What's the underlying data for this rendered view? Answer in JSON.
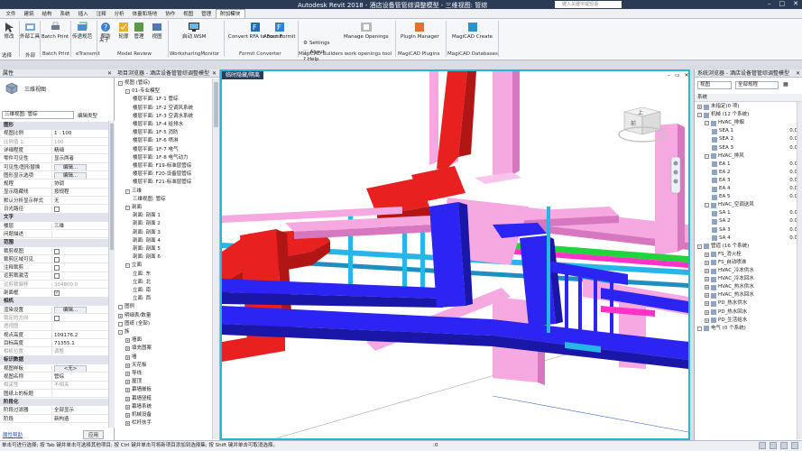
{
  "titlebar": {
    "app_title": "Autodesk Revit 2018 -",
    "doc_title": "酒店设备管管综调整模型 - 三维视图: 管综",
    "search_placeholder": "键入关键字或短语"
  },
  "tabs": [
    "文件",
    "建筑",
    "结构",
    "系统",
    "插入",
    "注释",
    "分析",
    "体量和场地",
    "协作",
    "视图",
    "管理",
    "附加模块"
  ],
  "addin_tabs": [
    "设置定义",
    "给排水",
    "消防系统",
    "计算工具",
    "风系统",
    "水系统",
    "详细信息",
    "多专业系统",
    "模型检查",
    "标注",
    "管道",
    "标准",
    "专业综合",
    "系统图/电气工具",
    "出图统计",
    "模板",
    "通用工具"
  ],
  "active_tab": "附加模块",
  "ribbon": {
    "buttons": [
      "修改",
      "外部工具",
      "Batch Print",
      "传递规范",
      "帮助",
      "关于",
      "轮廓",
      "管理",
      "视图",
      "启动 WSM",
      "Convert RFA to Formit",
      "About Formit",
      "Manage Openings",
      "Plugin Manager",
      "MagiCAD Create"
    ],
    "small": [
      "Settings",
      "About",
      "Help"
    ],
    "groups": [
      "选择",
      "外部",
      "Batch Print",
      "eTransmit",
      "Model Review",
      "WorksharingMonitor",
      "Formit Converter",
      "MagiCAD Builders work openings tool",
      "MagiCAD Plugins",
      "MagiCAD Databases"
    ]
  },
  "properties": {
    "title": "属性",
    "type_name": "三维视图",
    "selector": "三维视图: 管综",
    "edit_type": "编辑类型",
    "rows": [
      {
        "k": "图形",
        "v": "",
        "sec": true
      },
      {
        "k": "视图比例",
        "v": "1 : 100"
      },
      {
        "k": "比例值 1:",
        "v": "100",
        "dis": true
      },
      {
        "k": "详细程度",
        "v": "精细"
      },
      {
        "k": "零件可见性",
        "v": "显示两者"
      },
      {
        "k": "可见性/图形替换",
        "v": "编辑...",
        "btn": true
      },
      {
        "k": "图形显示选项",
        "v": "编辑...",
        "btn": true
      },
      {
        "k": "规程",
        "v": "协调"
      },
      {
        "k": "显示隐藏线",
        "v": "按规程"
      },
      {
        "k": "默认分析显示样式",
        "v": "无"
      },
      {
        "k": "日光路径",
        "v": "",
        "cb": true
      },
      {
        "k": "文字",
        "v": "",
        "sec": true
      },
      {
        "k": "楼层",
        "v": "三维"
      },
      {
        "k": "问题描述",
        "v": ""
      },
      {
        "k": "范围",
        "v": "",
        "sec": true
      },
      {
        "k": "裁剪视图",
        "v": "",
        "cb": true
      },
      {
        "k": "裁剪区域可见",
        "v": "",
        "cb": true
      },
      {
        "k": "注释裁剪",
        "v": "",
        "cb": true
      },
      {
        "k": "远剪裁激活",
        "v": "",
        "cb": true
      },
      {
        "k": "远剪裁偏移",
        "v": "304800.0",
        "dis": true
      },
      {
        "k": "剖面框",
        "v": "",
        "cb": true,
        "checked": true
      },
      {
        "k": "相机",
        "v": "",
        "sec": true
      },
      {
        "k": "渲染设置",
        "v": "编辑...",
        "btn": true
      },
      {
        "k": "锁定的方向",
        "v": "",
        "cb": true,
        "dis": true
      },
      {
        "k": "透视图",
        "v": "",
        "dis": true
      },
      {
        "k": "视点高度",
        "v": "109176.2"
      },
      {
        "k": "目标高度",
        "v": "71355.1"
      },
      {
        "k": "相机位置",
        "v": "调整",
        "dis": true
      },
      {
        "k": "标识数据",
        "v": "",
        "sec": true
      },
      {
        "k": "视图样板",
        "v": "<无>",
        "btn": true
      },
      {
        "k": "视图名称",
        "v": "管综"
      },
      {
        "k": "相关性",
        "v": "不相关",
        "dis": true
      },
      {
        "k": "图纸上的标题",
        "v": ""
      },
      {
        "k": "阶段化",
        "v": "",
        "sec": true
      },
      {
        "k": "阶段过滤器",
        "v": "全部显示"
      },
      {
        "k": "阶段",
        "v": "新构造"
      }
    ],
    "help_link": "属性帮助",
    "apply": "应用"
  },
  "project_browser": {
    "title": "项目浏览器 - 酒店设备管管综调整模型",
    "items": [
      {
        "t": "视图 (管综)",
        "lvl": 0,
        "sq": "-"
      },
      {
        "t": "01-专业模型",
        "lvl": 1,
        "sq": "-"
      },
      {
        "t": "楼层平面: 1F-1 管综",
        "lvl": 2
      },
      {
        "t": "楼层平面: 1F-2 空调风系统",
        "lvl": 2
      },
      {
        "t": "楼层平面: 1F-3 空调水系统",
        "lvl": 2
      },
      {
        "t": "楼层平面: 1F-4 给排水",
        "lvl": 2
      },
      {
        "t": "楼层平面: 1F-5 消防",
        "lvl": 2
      },
      {
        "t": "楼层平面: 1F-6 喷淋",
        "lvl": 2
      },
      {
        "t": "楼层平面: 1F-7 电气",
        "lvl": 2
      },
      {
        "t": "楼层平面: 1F-8 电气动力",
        "lvl": 2
      },
      {
        "t": "楼层平面: F19-标准层管综",
        "lvl": 2
      },
      {
        "t": "楼层平面: F20-设备层管综",
        "lvl": 2
      },
      {
        "t": "楼层平面: F21-标准层管综",
        "lvl": 2
      },
      {
        "t": "三维",
        "lvl": 1,
        "sq": "-"
      },
      {
        "t": "三维视图: 管综",
        "lvl": 2
      },
      {
        "t": "剖面",
        "lvl": 1,
        "sq": "-"
      },
      {
        "t": "剖面: 剖面 1",
        "lvl": 2
      },
      {
        "t": "剖面: 剖面 2",
        "lvl": 2
      },
      {
        "t": "剖面: 剖面 3",
        "lvl": 2
      },
      {
        "t": "剖面: 剖面 4",
        "lvl": 2
      },
      {
        "t": "剖面: 剖面 5",
        "lvl": 2
      },
      {
        "t": "剖面: 剖面 6",
        "lvl": 2
      },
      {
        "t": "立面",
        "lvl": 1,
        "sq": "-"
      },
      {
        "t": "立面: 东",
        "lvl": 2
      },
      {
        "t": "立面: 北",
        "lvl": 2
      },
      {
        "t": "立面: 南",
        "lvl": 2
      },
      {
        "t": "立面: 西",
        "lvl": 2
      },
      {
        "t": "图例",
        "lvl": 0,
        "sq": " "
      },
      {
        "t": "明细表/数量",
        "lvl": 0,
        "sq": "+"
      },
      {
        "t": "图纸 (全部)",
        "lvl": 0,
        "sq": " "
      },
      {
        "t": "族",
        "lvl": 0,
        "sq": "-"
      },
      {
        "t": "墙面",
        "lvl": 1,
        "sq": "+"
      },
      {
        "t": "填充图案",
        "lvl": 1,
        "sq": "+"
      },
      {
        "t": "墙",
        "lvl": 1,
        "sq": "+"
      },
      {
        "t": "天花板",
        "lvl": 1,
        "sq": "+"
      },
      {
        "t": "导线",
        "lvl": 1,
        "sq": "+"
      },
      {
        "t": "屋顶",
        "lvl": 1,
        "sq": "+"
      },
      {
        "t": "幕墙嵌板",
        "lvl": 1,
        "sq": "+"
      },
      {
        "t": "幕墙竖梃",
        "lvl": 1,
        "sq": "+"
      },
      {
        "t": "幕墙系统",
        "lvl": 1,
        "sq": "+"
      },
      {
        "t": "机械设备",
        "lvl": 1,
        "sq": "+"
      },
      {
        "t": "栏杆扶手",
        "lvl": 1,
        "sq": "+"
      }
    ]
  },
  "view": {
    "tab": "临时隐藏/隔离",
    "cube_top": "上",
    "cube_front": "前"
  },
  "system_browser": {
    "title": "系统浏览器 - 酒店设备管管综调整模型",
    "view_sel": "视图",
    "filter_sel": "全部规程",
    "head_system": "系统",
    "rows": [
      {
        "t": "未指定(0 项)",
        "lvl": 0,
        "sq": "+"
      },
      {
        "t": "机械 (12 个系统)",
        "lvl": 0,
        "sq": "-"
      },
      {
        "t": "HVAC_排烟",
        "lvl": 1,
        "sq": "-"
      },
      {
        "t": "SEA 1",
        "lvl": 2,
        "v": "0.0"
      },
      {
        "t": "SEA 2",
        "lvl": 2,
        "v": "0.0"
      },
      {
        "t": "SEA 3",
        "lvl": 2,
        "v": "0.0"
      },
      {
        "t": "HVAC_排风",
        "lvl": 1,
        "sq": "-"
      },
      {
        "t": "EA 1",
        "lvl": 2,
        "v": "0.0"
      },
      {
        "t": "EA 2",
        "lvl": 2,
        "v": "0.0"
      },
      {
        "t": "EA 3",
        "lvl": 2,
        "v": "0.0"
      },
      {
        "t": "EA 4",
        "lvl": 2,
        "v": "0.0"
      },
      {
        "t": "EA 5",
        "lvl": 2,
        "v": "0.0"
      },
      {
        "t": "HVAC_空调送风",
        "lvl": 1,
        "sq": "-"
      },
      {
        "t": "SA 1",
        "lvl": 2,
        "v": "0.0"
      },
      {
        "t": "SA 2",
        "lvl": 2,
        "v": "0.0"
      },
      {
        "t": "SA 3",
        "lvl": 2,
        "v": "0.0"
      },
      {
        "t": "SA 4",
        "lvl": 2,
        "v": "0.0"
      },
      {
        "t": "管道 (16 个系统)",
        "lvl": 0,
        "sq": "-"
      },
      {
        "t": "FS_消火栓",
        "lvl": 1,
        "sq": "+"
      },
      {
        "t": "FS_自动喷淋",
        "lvl": 1,
        "sq": "+"
      },
      {
        "t": "HVAC_冷冻供水",
        "lvl": 1,
        "sq": "+"
      },
      {
        "t": "HVAC_冷冻回水",
        "lvl": 1,
        "sq": "+"
      },
      {
        "t": "HVAC_热水供水",
        "lvl": 1,
        "sq": "+"
      },
      {
        "t": "HVAC_热水回水",
        "lvl": 1,
        "sq": "+"
      },
      {
        "t": "PD_热水供水",
        "lvl": 1,
        "sq": "+"
      },
      {
        "t": "PD_热水回水",
        "lvl": 1,
        "sq": "+"
      },
      {
        "t": "PD_生活给水",
        "lvl": 1,
        "sq": "+"
      },
      {
        "t": "电气 (0 个系统)",
        "lvl": 0,
        "sq": " "
      }
    ]
  },
  "status": {
    "text": "单击可进行选择; 按 Tab 键并单击可选择其他项目; 按 Ctrl 键并单击可将新项目添加到选择集; 按 Shift 键并单击可取消选择。",
    "zero": ":0"
  },
  "colors": {
    "accent": "#26b7d4",
    "titlebar": "#2b3a55",
    "duct_red": "#e8201f",
    "pipe_blue": "#2b24f2",
    "pipe_pink": "#f6a8e0",
    "pipe_cyan": "#27b6e8",
    "pipe_green": "#1fd53a",
    "pipe_magenta": "#ff32c8"
  }
}
